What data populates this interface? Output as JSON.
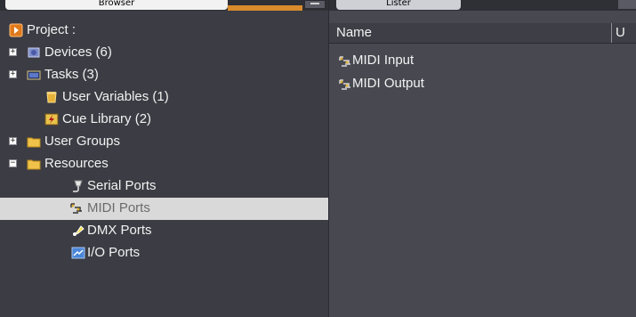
{
  "left_panel": {
    "tab_label": "Browser"
  },
  "tree": {
    "root": {
      "label": "Project :",
      "icon": "project-icon",
      "color": "#d98a2b"
    },
    "items": [
      {
        "label": "Devices (6)",
        "expander": "+",
        "icon": "devices-icon"
      },
      {
        "label": "Tasks (3)",
        "expander": "+",
        "icon": "tasks-icon"
      },
      {
        "label": "User Variables (1)",
        "expander": "",
        "icon": "user-variables-icon"
      },
      {
        "label": "Cue Library (2)",
        "expander": "",
        "icon": "cue-library-icon"
      },
      {
        "label": "User Groups",
        "expander": "+",
        "icon": "folder-icon"
      },
      {
        "label": "Resources",
        "expander": "−",
        "icon": "folder-icon"
      }
    ],
    "resources_children": [
      {
        "label": "Serial Ports",
        "icon": "serial-port-icon",
        "selected": false
      },
      {
        "label": "MIDI Ports",
        "icon": "midi-port-icon",
        "selected": true
      },
      {
        "label": "DMX Ports",
        "icon": "dmx-port-icon",
        "selected": false
      },
      {
        "label": "I/O Ports",
        "icon": "io-port-icon",
        "selected": false
      }
    ]
  },
  "right_panel": {
    "tab_label": "Lister",
    "columns": [
      "Name",
      "U"
    ],
    "rows": [
      {
        "name": "MIDI Input",
        "icon": "midi-port-icon"
      },
      {
        "name": "MIDI Output",
        "icon": "midi-port-icon"
      }
    ]
  },
  "colors": {
    "background": "#3c3c44",
    "selection": "#d9d9d9",
    "accent": "#d98a2b",
    "text": "#f2f2f2"
  }
}
